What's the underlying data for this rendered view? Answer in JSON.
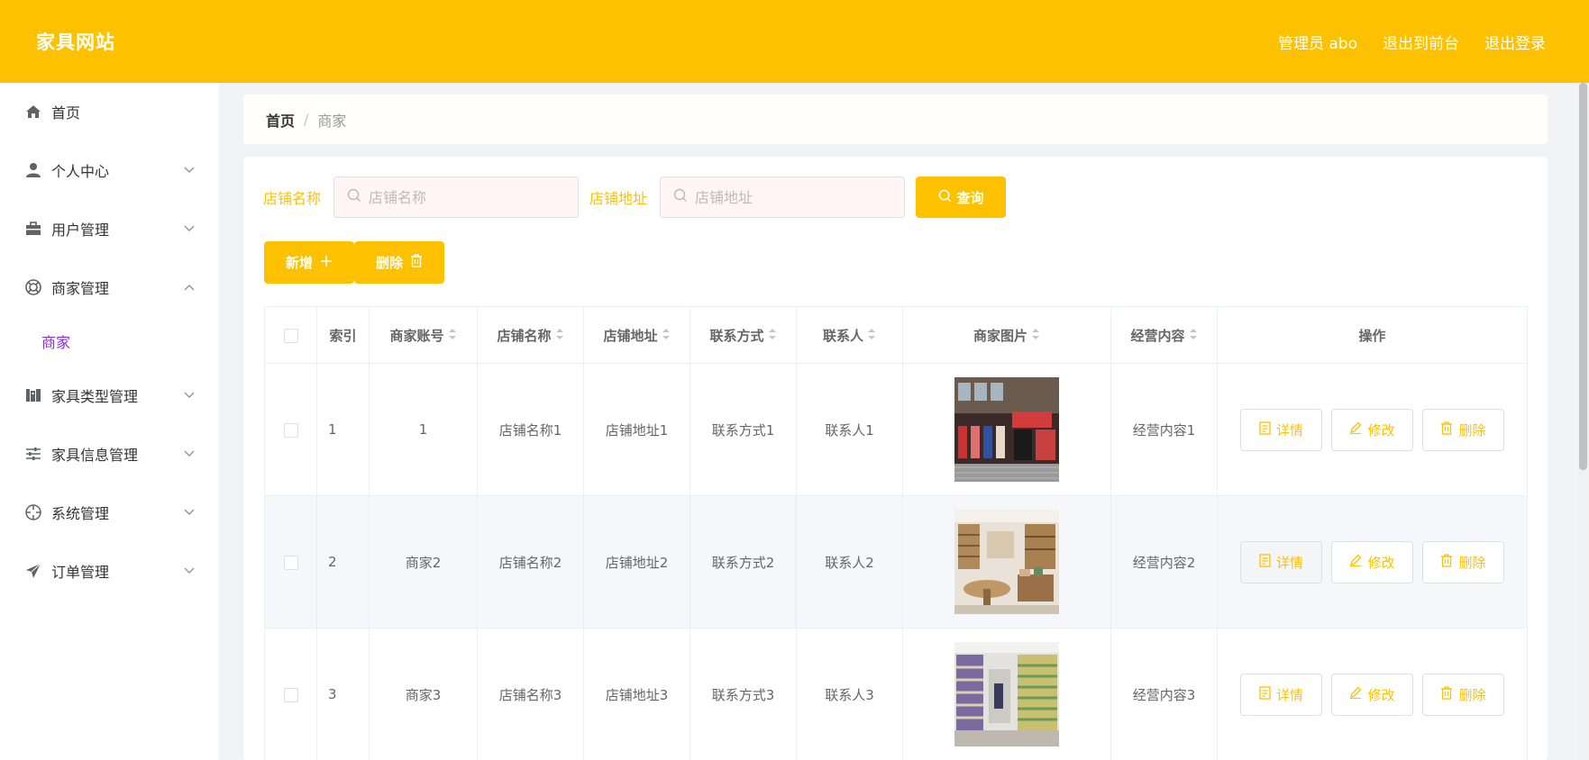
{
  "header": {
    "brand": "家具网站",
    "links": [
      "管理员 abo",
      "退出到前台",
      "退出登录"
    ]
  },
  "sidebar": {
    "items": [
      {
        "label": "首页",
        "icon": "home-icon"
      },
      {
        "label": "个人中心",
        "icon": "user-icon"
      },
      {
        "label": "用户管理",
        "icon": "briefcase-icon"
      },
      {
        "label": "商家管理",
        "icon": "lifebuoy-icon"
      },
      {
        "label": "家具类型管理",
        "icon": "building-icon"
      },
      {
        "label": "家具信息管理",
        "icon": "sliders-icon"
      },
      {
        "label": "系统管理",
        "icon": "compass-icon"
      },
      {
        "label": "订单管理",
        "icon": "send-icon"
      }
    ],
    "submenu": {
      "label": "商家"
    }
  },
  "breadcrumb": {
    "home": "首页",
    "sep": "/",
    "current": "商家"
  },
  "search": {
    "field1_label": "店铺名称",
    "field1_placeholder": "店铺名称",
    "field2_label": "店铺地址",
    "field2_placeholder": "店铺地址",
    "query_label": "查询"
  },
  "actions": {
    "add_label": "新增",
    "delete_label": "删除"
  },
  "table": {
    "headers": [
      "索引",
      "商家账号",
      "店铺名称",
      "店铺地址",
      "联系方式",
      "联系人",
      "商家图片",
      "经营内容",
      "操作"
    ],
    "rows": [
      {
        "index": "1",
        "account": "1",
        "name": "店铺名称1",
        "address": "店铺地址1",
        "contact": "联系方式1",
        "person": "联系人1",
        "content": "经营内容1"
      },
      {
        "index": "2",
        "account": "商家2",
        "name": "店铺名称2",
        "address": "店铺地址2",
        "contact": "联系方式2",
        "person": "联系人2",
        "content": "经营内容2"
      },
      {
        "index": "3",
        "account": "商家3",
        "name": "店铺名称3",
        "address": "店铺地址3",
        "contact": "联系方式3",
        "person": "联系人3",
        "content": "经营内容3"
      }
    ],
    "op_labels": {
      "detail": "详情",
      "edit": "修改",
      "delete": "删除"
    }
  },
  "colors": {
    "accent": "#fdc100",
    "submenu_active": "#8a2be2"
  }
}
